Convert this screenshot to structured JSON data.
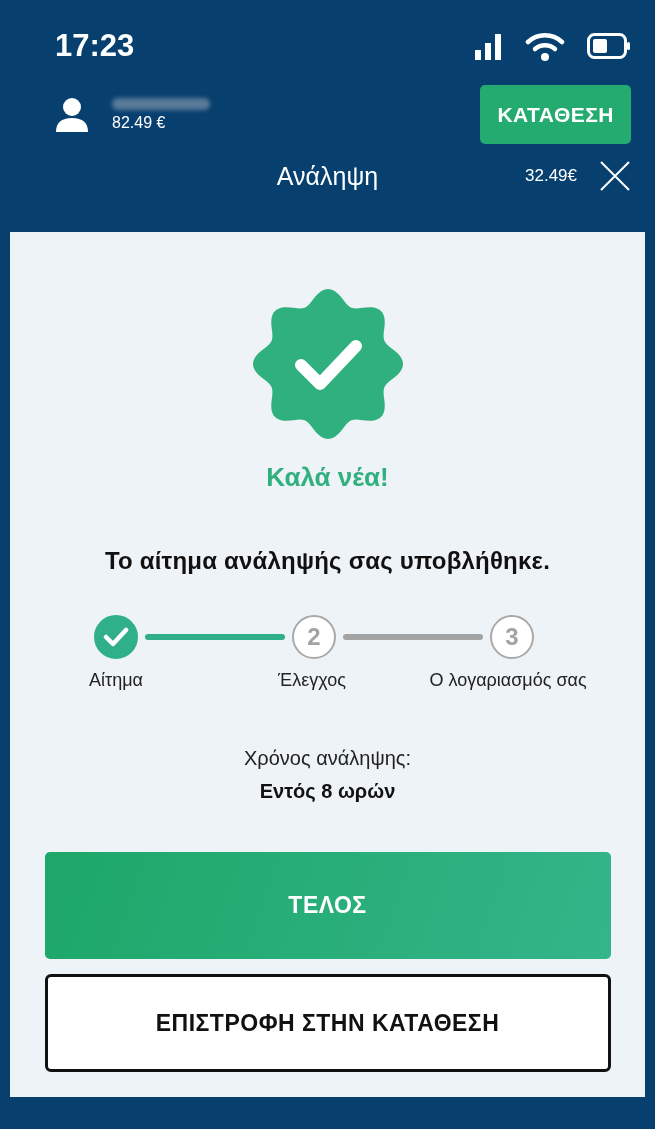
{
  "status_bar": {
    "time": "17:23"
  },
  "account": {
    "balance": "82.49 €",
    "name_hidden": true
  },
  "deposit_button": "ΚΑΤΑΘΕΣΗ",
  "header": {
    "title": "Ανάληψη",
    "amount": "32.49€"
  },
  "result": {
    "heading": "Καλά νέα!",
    "message": "Το αίτημα ανάληψής σας υποβλήθηκε."
  },
  "steps": [
    {
      "label": "Αίτημα",
      "done": true
    },
    {
      "label": "Έλεγχος",
      "number": "2",
      "done": false
    },
    {
      "label": "Ο λογαριασμός σας",
      "number": "3",
      "done": false
    }
  ],
  "withdrawal_time": {
    "label": "Χρόνος ανάληψης:",
    "value": "Εντός 8 ωρών"
  },
  "buttons": [
    {
      "label": "ΤΕΛΟΣ",
      "kind": "primary"
    },
    {
      "label": "ΕΠΙΣΤΡΟΦΗ ΣΤΗΝ ΚΑΤΑΘΕΣΗ",
      "kind": "secondary"
    }
  ]
}
